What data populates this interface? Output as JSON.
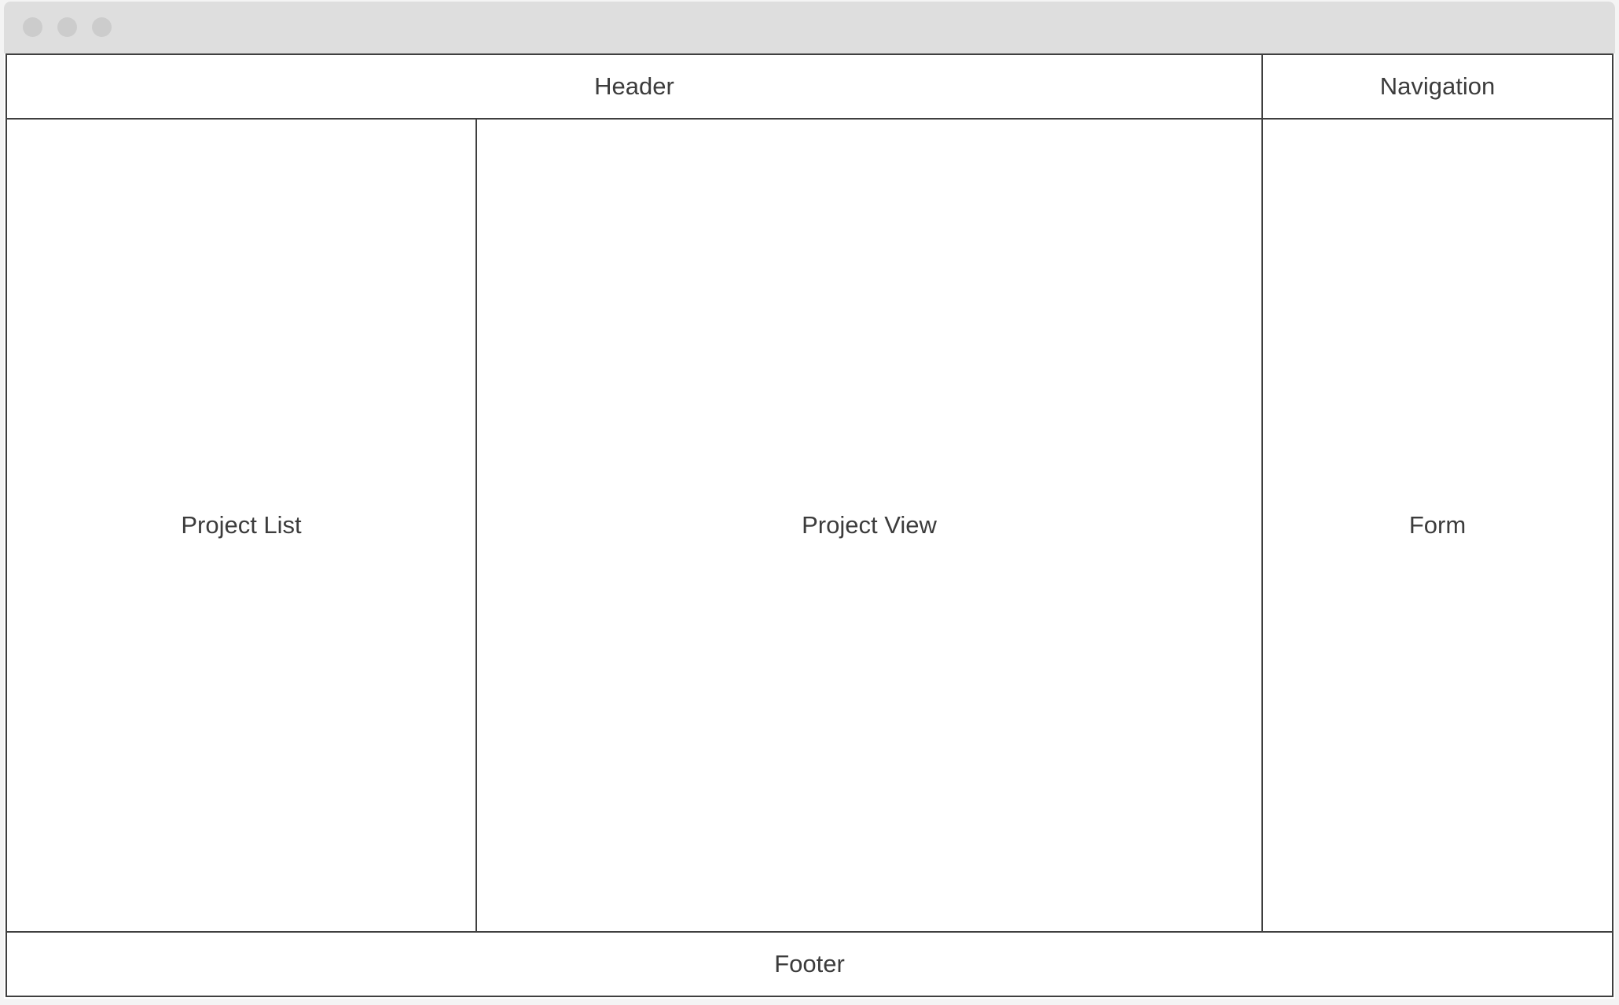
{
  "window": {
    "controls": [
      "window-dot",
      "window-dot",
      "window-dot"
    ]
  },
  "layout": {
    "header": "Header",
    "navigation": "Navigation",
    "project_list": "Project List",
    "project_view": "Project View",
    "form": "Form",
    "footer": "Footer"
  },
  "colors": {
    "titlebar": "#dedede",
    "window_dot": "#cccccc",
    "border": "#3f3f3f",
    "text": "#3c3c3c",
    "background": "#ffffff"
  }
}
